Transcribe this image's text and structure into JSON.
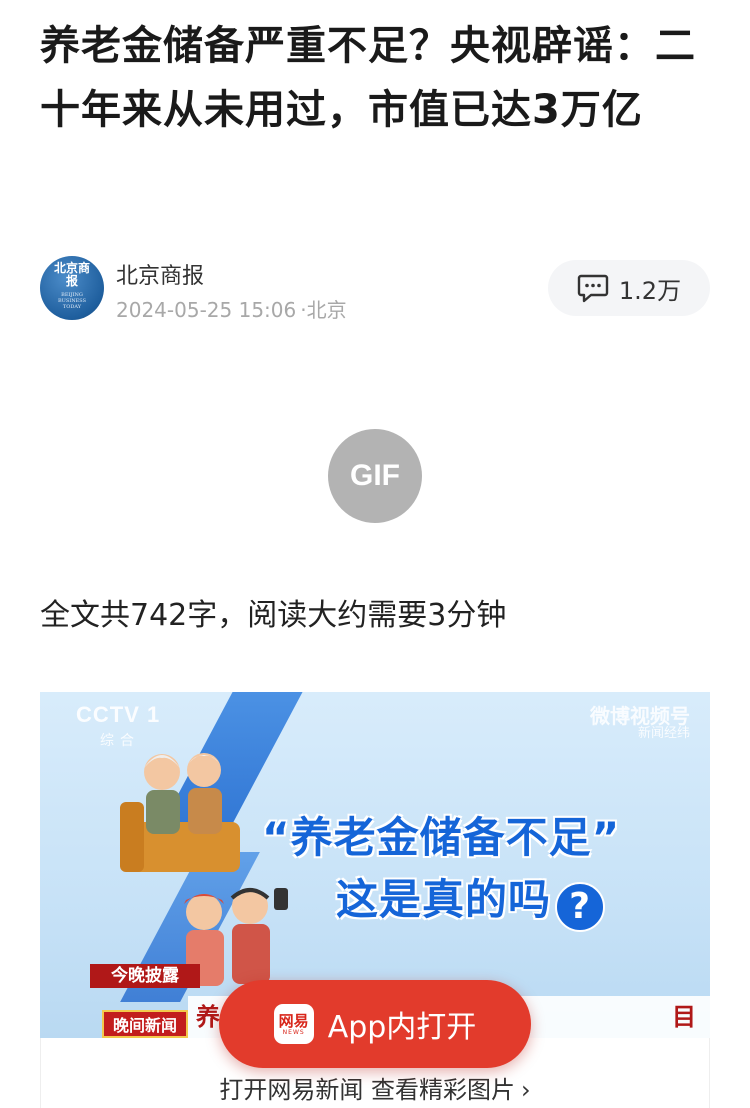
{
  "article": {
    "title": "养老金储备严重不足？央视辟谣：二十年来从未用过，市值已达3万亿",
    "read_info": "全文共742字，阅读大约需要3分钟"
  },
  "author": {
    "name": "北京商报",
    "avatar_text": "北京商报",
    "avatar_subtext": "BEIJING BUSINESS TODAY",
    "datetime": "2024-05-25 15:06",
    "location": "·北京"
  },
  "comments": {
    "count": "1.2万",
    "icon": "comment-bubble-icon"
  },
  "media": {
    "gif_badge": "GIF",
    "video_frame": {
      "channel_logo": "CCTV 1",
      "channel_sub": "综合",
      "watermark": "微博视频号",
      "watermark_sub": "新闻经纬",
      "headline_line1": "“养老金储备不足”",
      "headline_line2": "这是真的吗",
      "question_mark": "?",
      "program_tag": "今晚披露",
      "news_tag": "晚间新闻",
      "ticker_left": "养",
      "ticker_right": "目"
    }
  },
  "app_banner": {
    "button_label": "App内打开",
    "logo_cn": "网易",
    "logo_en": "NEWS",
    "footer_link": "打开网易新闻 查看精彩图片",
    "footer_chevron": "›"
  },
  "colors": {
    "accent_red": "#e23b2c",
    "video_blue": "#1565d8",
    "meta_gray": "#a8a8a8"
  }
}
